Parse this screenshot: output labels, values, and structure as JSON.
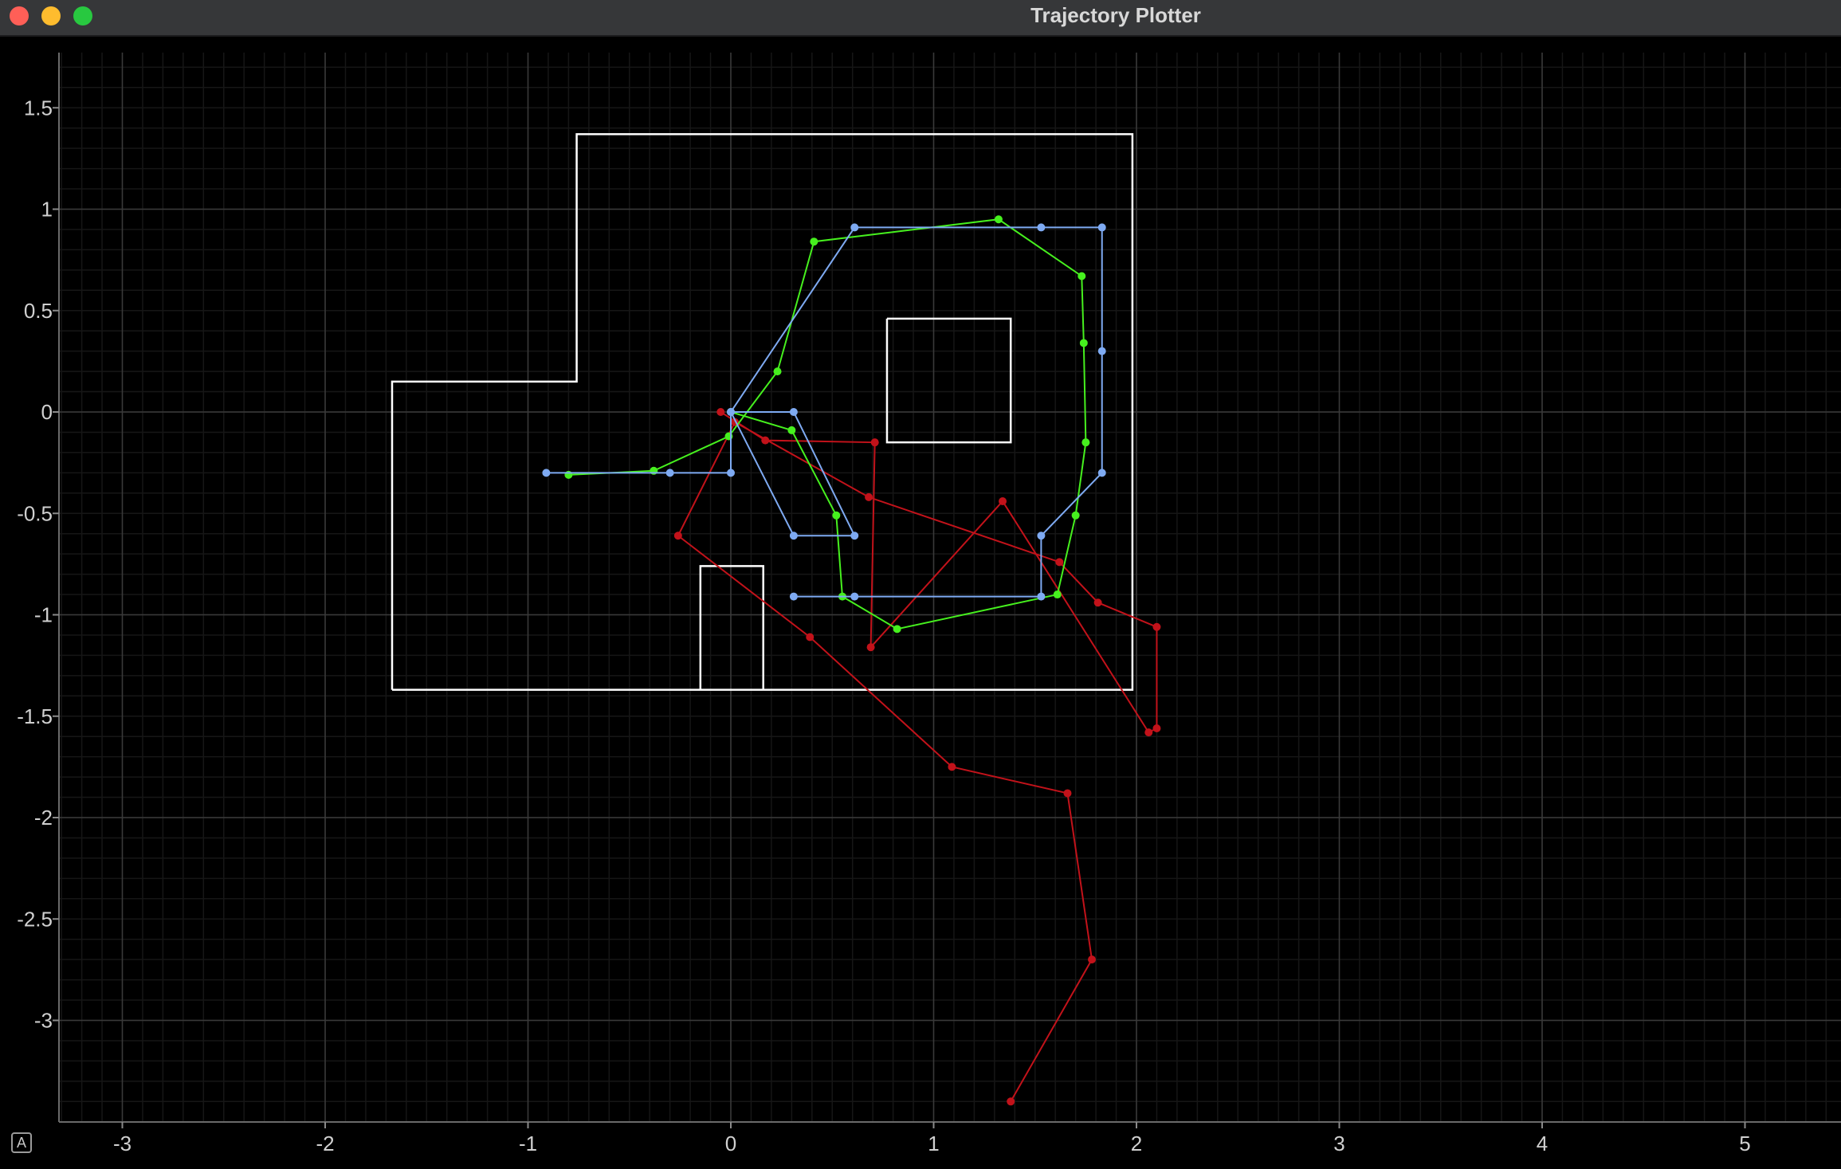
{
  "window": {
    "title": "Trajectory Plotter",
    "auto_range_label": "A"
  },
  "colors": {
    "background": "#000000",
    "grid_minor": "#161616",
    "grid_major": "#3a3a3a",
    "axis_text": "#d0d0d0",
    "walls": "#ffffff",
    "trajectory_red": "#c2121a",
    "trajectory_green": "#46f01e",
    "trajectory_blue": "#7eaaf2"
  },
  "chart_data": {
    "type": "line",
    "title": "",
    "xlabel": "",
    "ylabel": "",
    "xlim": [
      -3.3,
      5.5
    ],
    "ylim": [
      -3.5,
      1.75
    ],
    "x_ticks": [
      "-3",
      "-2",
      "-1",
      "0",
      "1",
      "2",
      "3",
      "4",
      "5"
    ],
    "y_ticks": [
      "1.5",
      "1",
      "0.5",
      "0",
      "-0.5",
      "-1",
      "-1.5",
      "-2",
      "-2.5",
      "-3"
    ],
    "grid": true,
    "walls": [
      [
        [
          -1.67,
          -1.37
        ],
        [
          -1.67,
          0.15
        ],
        [
          -0.76,
          0.15
        ],
        [
          -0.76,
          1.37
        ],
        [
          1.98,
          1.37
        ],
        [
          1.98,
          -1.37
        ],
        [
          -1.67,
          -1.37
        ]
      ],
      [
        [
          0.77,
          0.46
        ],
        [
          1.38,
          0.46
        ],
        [
          1.38,
          -0.15
        ],
        [
          0.77,
          -0.15
        ],
        [
          0.77,
          0.46
        ]
      ],
      [
        [
          -0.15,
          -1.37
        ],
        [
          -0.15,
          -0.76
        ],
        [
          0.16,
          -0.76
        ],
        [
          0.16,
          -1.37
        ]
      ]
    ],
    "series": [
      {
        "color": "red",
        "points": [
          [
            -0.05,
            0.0
          ],
          [
            0.17,
            -0.14
          ],
          [
            0.71,
            -0.15
          ],
          [
            0.69,
            -1.16
          ],
          [
            1.34,
            -0.44
          ],
          [
            2.06,
            -1.58
          ],
          [
            2.1,
            -1.56
          ],
          [
            2.1,
            -1.06
          ],
          [
            1.81,
            -0.94
          ],
          [
            1.62,
            -0.74
          ],
          [
            0.68,
            -0.42
          ],
          [
            0.02,
            -0.05
          ],
          [
            -0.26,
            -0.61
          ],
          [
            0.39,
            -1.11
          ],
          [
            1.09,
            -1.75
          ],
          [
            1.66,
            -1.88
          ],
          [
            1.78,
            -2.7
          ],
          [
            1.38,
            -3.4
          ]
        ]
      },
      {
        "color": "green",
        "points": [
          [
            -0.8,
            -0.31
          ],
          [
            -0.38,
            -0.29
          ],
          [
            -0.01,
            -0.12
          ],
          [
            0.23,
            0.2
          ],
          [
            0.41,
            0.84
          ],
          [
            1.32,
            0.95
          ],
          [
            1.73,
            0.67
          ],
          [
            1.74,
            0.34
          ],
          [
            1.75,
            -0.15
          ],
          [
            1.7,
            -0.51
          ],
          [
            1.61,
            -0.9
          ],
          [
            0.82,
            -1.07
          ],
          [
            0.55,
            -0.91
          ],
          [
            0.52,
            -0.51
          ],
          [
            0.3,
            -0.09
          ],
          [
            0.0,
            0.0
          ]
        ]
      },
      {
        "color": "blue",
        "points": [
          [
            -0.91,
            -0.3
          ],
          [
            -0.3,
            -0.3
          ],
          [
            0.0,
            -0.3
          ],
          [
            0.0,
            0.0
          ],
          [
            0.31,
            0.0
          ],
          [
            0.61,
            -0.61
          ],
          [
            0.31,
            -0.61
          ],
          [
            0.0,
            0.0
          ],
          [
            0.61,
            0.91
          ],
          [
            1.53,
            0.91
          ],
          [
            1.83,
            0.91
          ],
          [
            1.83,
            0.3
          ],
          [
            1.83,
            -0.3
          ],
          [
            1.53,
            -0.61
          ],
          [
            1.53,
            -0.91
          ],
          [
            0.61,
            -0.91
          ],
          [
            0.31,
            -0.91
          ]
        ]
      }
    ]
  }
}
